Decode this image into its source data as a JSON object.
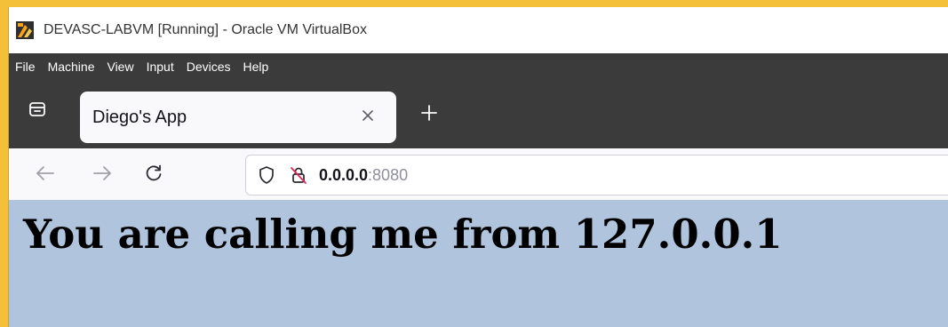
{
  "window": {
    "title": "DEVASC-LABVM [Running] - Oracle VM VirtualBox",
    "logo_icon": "virtualbox-logo-icon",
    "frame_color": "#f4c03a"
  },
  "menubar": {
    "items": [
      "File",
      "Machine",
      "View",
      "Input",
      "Devices",
      "Help"
    ]
  },
  "browser": {
    "tab": {
      "title": "Diego's App",
      "close_icon": "close-icon"
    },
    "new_tab_icon": "plus-icon",
    "overview_icon": "tab-overview-icon",
    "nav": {
      "back_icon": "back-arrow-icon",
      "forward_icon": "forward-arrow-icon",
      "reload_icon": "reload-icon"
    },
    "url": {
      "host": "0.0.0.0",
      "port": ":8080",
      "shield_icon": "tracking-protection-shield-icon",
      "lock_icon": "insecure-lock-icon"
    }
  },
  "page": {
    "heading": "You are calling me from 127.0.0.1",
    "background": "#b0c4de"
  }
}
